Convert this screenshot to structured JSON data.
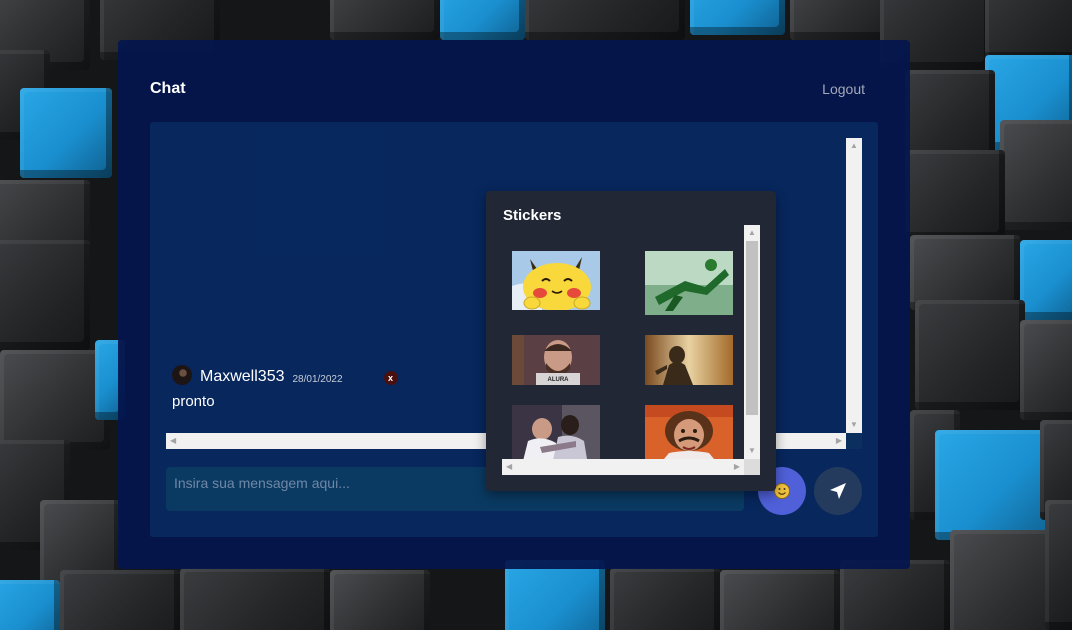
{
  "chat": {
    "title": "Chat",
    "logout_label": "Logout"
  },
  "messages": [
    {
      "username": "Maxwell353",
      "date": "28/01/2022",
      "text": "pronto",
      "delete_label": "x"
    }
  ],
  "input": {
    "placeholder": "Insira sua mensagem aqui...",
    "value": ""
  },
  "stickers_panel": {
    "title": "Stickers",
    "items": [
      {
        "name": "pikachu-sticker"
      },
      {
        "name": "green-soldier-sticker"
      },
      {
        "name": "alura-man-sticker"
      },
      {
        "name": "shadow-sticker"
      },
      {
        "name": "hug-sticker"
      },
      {
        "name": "curly-hair-man-sticker"
      }
    ]
  },
  "icons": {
    "emoji_button": "smiley-icon",
    "send_button": "send-arrow-icon"
  },
  "colors": {
    "panel_bg": "#04164e",
    "emoji_button": "#4f60d8",
    "send_button": "#243b5e",
    "stickers_bg": "#222735"
  }
}
